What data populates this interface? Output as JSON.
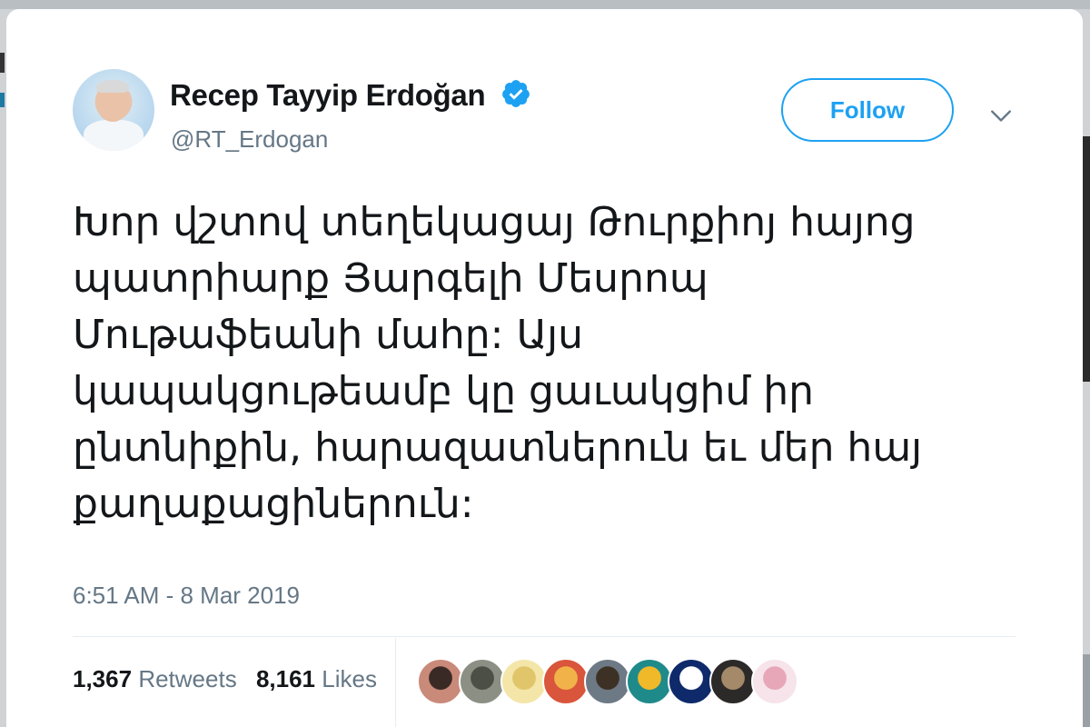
{
  "user": {
    "name": "Recep Tayyip Erdoğan",
    "handle": "@RT_Erdogan",
    "verified": true
  },
  "actions": {
    "follow_label": "Follow"
  },
  "tweet": {
    "lines": [
      "Խոր վշտով տեղեկացայ Թուրքիոյ հայոց",
      "պատրիարք Յարգելի Մեսրոպ",
      "Մութաֆեանի մահը: Այս",
      "կապակցութեամբ կը ցաւակցիմ իր",
      "ընտնիքին, հարազատներուն եւ մեր հայ",
      "քաղաքացիներուն:"
    ],
    "timestamp": "6:51 AM - 8 Mar 2019"
  },
  "stats": {
    "retweets_count": "1,367",
    "retweets_label": "Retweets",
    "likes_count": "8,161",
    "likes_label": "Likes"
  },
  "colors": {
    "accent": "#1da1f2",
    "text": "#14171a",
    "secondary": "#657786",
    "verified": "#1da1f2"
  },
  "likers": [
    {
      "name": "liker-avatar-1",
      "bg": "#c98a7a",
      "fg": "#3a2a25"
    },
    {
      "name": "liker-avatar-2",
      "bg": "#8b8f84",
      "fg": "#4b4f45"
    },
    {
      "name": "liker-avatar-3",
      "bg": "#f3e6a8",
      "fg": "#e0c56a"
    },
    {
      "name": "liker-avatar-4",
      "bg": "#d9553b",
      "fg": "#f2b24a"
    },
    {
      "name": "liker-avatar-5",
      "bg": "#6d7a86",
      "fg": "#3d3125"
    },
    {
      "name": "liker-avatar-6",
      "bg": "#1f8a8a",
      "fg": "#f0b92a"
    },
    {
      "name": "liker-avatar-7",
      "bg": "#0e2a6b",
      "fg": "#ffffff"
    },
    {
      "name": "liker-avatar-8",
      "bg": "#2c2a28",
      "fg": "#a58a6a"
    },
    {
      "name": "liker-avatar-9",
      "bg": "#f6e4ea",
      "fg": "#e7a7b8"
    }
  ]
}
